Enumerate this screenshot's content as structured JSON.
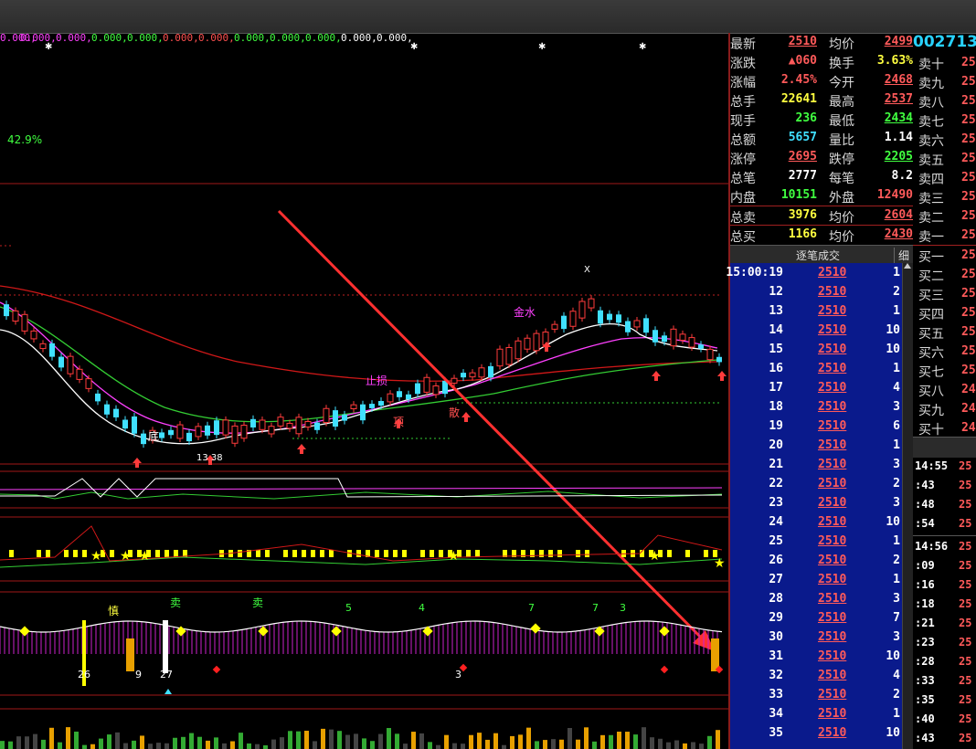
{
  "indicator_values": [
    "0.000,",
    "0.000,",
    "0.000,",
    "0.000,",
    "0.000,",
    "0.000,",
    "0.000,",
    "0.000,",
    "0.000,",
    "0.000,",
    "0.000,",
    "0.000,"
  ],
  "percent_label": "42.9%",
  "chart_marks": {
    "top_k": "X",
    "jin_shui": "金水",
    "zhi_jian": "止损",
    "di": "底",
    "ding": "顶",
    "sao": "散",
    "bottom_nums": "13 38",
    "sell_label": "卖",
    "sell_label2": "卖",
    "shen_label": "慎",
    "num_26": "26",
    "num_9": "9",
    "num_27": "27",
    "num_3": "3",
    "num_5": "5",
    "num_4": "4",
    "num_7a": "7",
    "num_7b": "7",
    "num_3b": "3"
  },
  "colors": {
    "up": "#ff3b3b",
    "down": "#40e0ff",
    "ma_white": "#ffffff",
    "ma_magenta": "#ff40ff",
    "ma_green": "#33cc33",
    "ma_red": "#d01818",
    "yellow": "#ffff00",
    "trade_bg": "#0a1a8c"
  },
  "quote": {
    "rows": [
      {
        "l1": "最新",
        "v1": "2510",
        "c1": "#ff5a5a",
        "l2": "均价",
        "v2": "2499",
        "c2": "#ff5a5a",
        "u1": true,
        "u2": true
      },
      {
        "l1": "涨跌",
        "v1": "▲060",
        "c1": "#ff5a5a",
        "l2": "换手",
        "v2": "3.63%",
        "c2": "#ffff40"
      },
      {
        "l1": "涨幅",
        "v1": "2.45%",
        "c1": "#ff5a5a",
        "l2": "今开",
        "v2": "2468",
        "c2": "#ff5a5a",
        "u2": true
      },
      {
        "l1": "总手",
        "v1": "22641",
        "c1": "#ffff40",
        "l2": "最高",
        "v2": "2537",
        "c2": "#ff5a5a",
        "u2": true
      },
      {
        "l1": "现手",
        "v1": "236",
        "c1": "#40ff40",
        "l2": "最低",
        "v2": "2434",
        "c2": "#40ff40",
        "u2": true
      },
      {
        "l1": "总额",
        "v1": "5657",
        "c1": "#40e0ff",
        "l2": "量比",
        "v2": "1.14",
        "c2": "#ffffff"
      },
      {
        "l1": "涨停",
        "v1": "2695",
        "c1": "#ff5a5a",
        "l2": "跌停",
        "v2": "2205",
        "c2": "#40ff40",
        "u1": true,
        "u2": true
      },
      {
        "l1": "总笔",
        "v1": "2777",
        "c1": "#ffffff",
        "l2": "每笔",
        "v2": "8.2",
        "c2": "#ffffff"
      },
      {
        "l1": "内盘",
        "v1": "10151",
        "c1": "#40ff40",
        "l2": "外盘",
        "v2": "12490",
        "c2": "#ff5a5a"
      },
      {
        "l1": "总卖",
        "v1": "3976",
        "c1": "#ffff40",
        "l2": "均价",
        "v2": "2604",
        "c2": "#ff5a5a",
        "u2": true
      },
      {
        "l1": "总买",
        "v1": "1166",
        "c1": "#ffff40",
        "l2": "均价",
        "v2": "2430",
        "c2": "#ff5a5a",
        "u2": true
      }
    ]
  },
  "trades": {
    "title": "逐笔成交",
    "fine": "细",
    "rows": [
      {
        "t": "15:00:19",
        "p": "2510",
        "v": "1"
      },
      {
        "t": "12",
        "p": "2510",
        "v": "2"
      },
      {
        "t": "13",
        "p": "2510",
        "v": "1"
      },
      {
        "t": "14",
        "p": "2510",
        "v": "10"
      },
      {
        "t": "15",
        "p": "2510",
        "v": "10"
      },
      {
        "t": "16",
        "p": "2510",
        "v": "1"
      },
      {
        "t": "17",
        "p": "2510",
        "v": "4"
      },
      {
        "t": "18",
        "p": "2510",
        "v": "3"
      },
      {
        "t": "19",
        "p": "2510",
        "v": "6"
      },
      {
        "t": "20",
        "p": "2510",
        "v": "1"
      },
      {
        "t": "21",
        "p": "2510",
        "v": "3"
      },
      {
        "t": "22",
        "p": "2510",
        "v": "2"
      },
      {
        "t": "23",
        "p": "2510",
        "v": "3"
      },
      {
        "t": "24",
        "p": "2510",
        "v": "10"
      },
      {
        "t": "25",
        "p": "2510",
        "v": "1"
      },
      {
        "t": "26",
        "p": "2510",
        "v": "2"
      },
      {
        "t": "27",
        "p": "2510",
        "v": "1"
      },
      {
        "t": "28",
        "p": "2510",
        "v": "3"
      },
      {
        "t": "29",
        "p": "2510",
        "v": "7"
      },
      {
        "t": "30",
        "p": "2510",
        "v": "3"
      },
      {
        "t": "31",
        "p": "2510",
        "v": "10"
      },
      {
        "t": "32",
        "p": "2510",
        "v": "4"
      },
      {
        "t": "33",
        "p": "2510",
        "v": "2"
      },
      {
        "t": "34",
        "p": "2510",
        "v": "1"
      },
      {
        "t": "35",
        "p": "2510",
        "v": "10"
      }
    ]
  },
  "stock_code": "002713",
  "ladder": {
    "sell": [
      {
        "l": "卖十",
        "p": "25"
      },
      {
        "l": "卖九",
        "p": "25"
      },
      {
        "l": "卖八",
        "p": "25"
      },
      {
        "l": "卖七",
        "p": "25"
      },
      {
        "l": "卖六",
        "p": "25"
      },
      {
        "l": "卖五",
        "p": "25"
      },
      {
        "l": "卖四",
        "p": "25"
      },
      {
        "l": "卖三",
        "p": "25"
      },
      {
        "l": "卖二",
        "p": "25"
      },
      {
        "l": "卖一",
        "p": "25"
      }
    ],
    "buy": [
      {
        "l": "买一",
        "p": "25"
      },
      {
        "l": "买二",
        "p": "25"
      },
      {
        "l": "买三",
        "p": "25"
      },
      {
        "l": "买四",
        "p": "25"
      },
      {
        "l": "买五",
        "p": "25"
      },
      {
        "l": "买六",
        "p": "25"
      },
      {
        "l": "买七",
        "p": "25"
      },
      {
        "l": "买八",
        "p": "24"
      },
      {
        "l": "买九",
        "p": "24"
      },
      {
        "l": "买十",
        "p": "24"
      }
    ]
  },
  "ticks": [
    {
      "t": "14:55",
      "p": "25"
    },
    {
      "t": ":43",
      "p": "25"
    },
    {
      "t": ":48",
      "p": "25"
    },
    {
      "t": ":54",
      "p": "25"
    },
    {
      "t": "14:56",
      "p": "25"
    },
    {
      "t": ":09",
      "p": "25"
    },
    {
      "t": ":16",
      "p": "25"
    },
    {
      "t": ":18",
      "p": "25"
    },
    {
      "t": ":21",
      "p": "25"
    },
    {
      "t": ":23",
      "p": "25"
    },
    {
      "t": ":28",
      "p": "25"
    },
    {
      "t": ":33",
      "p": "25"
    },
    {
      "t": ":35",
      "p": "25"
    },
    {
      "t": ":40",
      "p": "25"
    },
    {
      "t": ":43",
      "p": "25"
    }
  ]
}
